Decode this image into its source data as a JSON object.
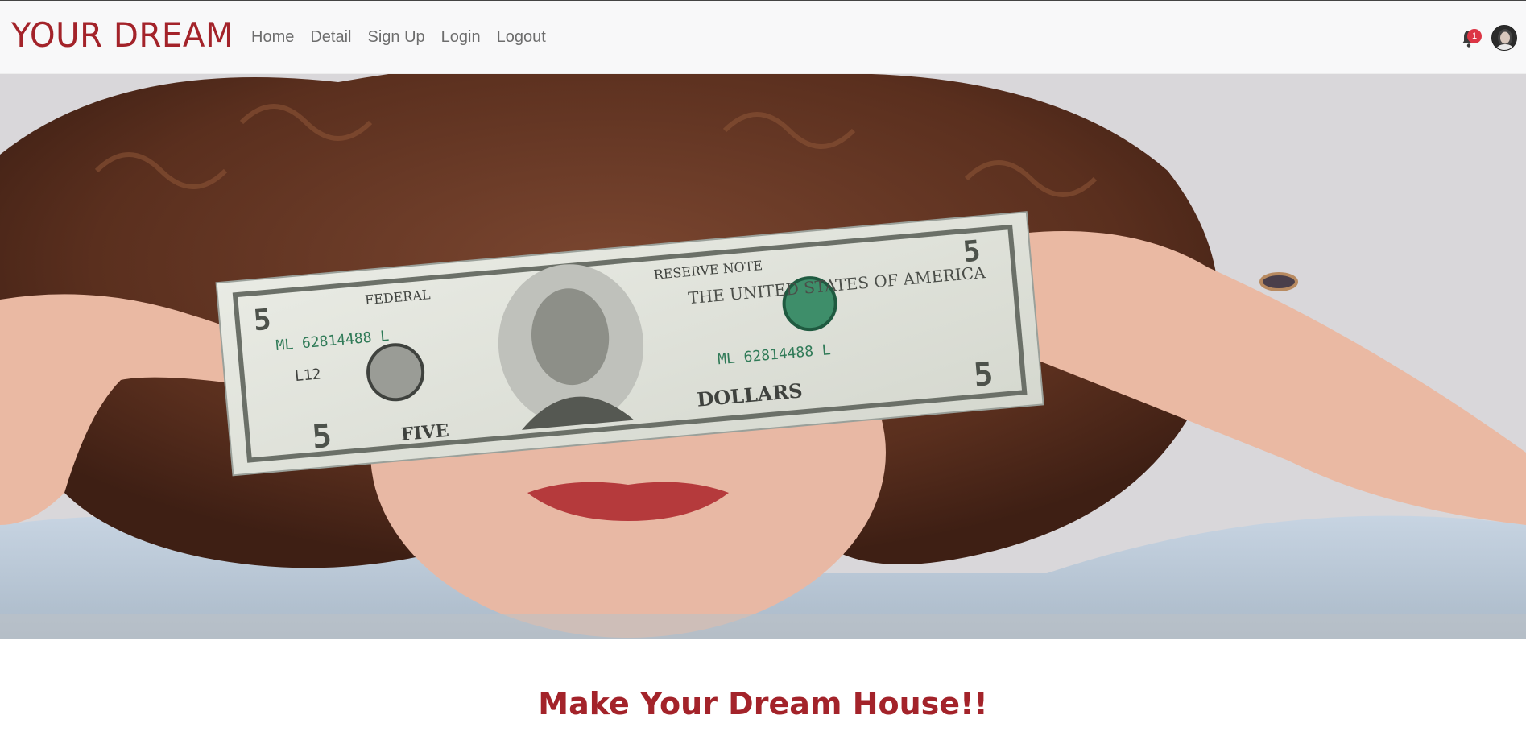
{
  "navbar": {
    "brand": "YOUR DREAM",
    "links": [
      "Home",
      "Detail",
      "Sign Up",
      "Login",
      "Logout"
    ],
    "notification_count": "1",
    "icons": {
      "bell": "bell-icon",
      "avatar": "user-avatar"
    }
  },
  "hero": {
    "image": "woman-holding-five-dollar-bill-photo",
    "bill_text": {
      "serial": "ML 62814488 L",
      "code": "L12",
      "denomination": "5",
      "header": "THE UNITED STATES OF AMERICA",
      "federal": "FEDERAL",
      "reserve": "RESERVE NOTE",
      "bottom_left": "FIVE",
      "bottom_right": "DOLLARS"
    }
  },
  "main": {
    "headline": "Make Your Dream House!!"
  },
  "colors": {
    "brand": "#a3232a",
    "nav_link": "#6d6d6d",
    "badge": "#dc3545"
  }
}
